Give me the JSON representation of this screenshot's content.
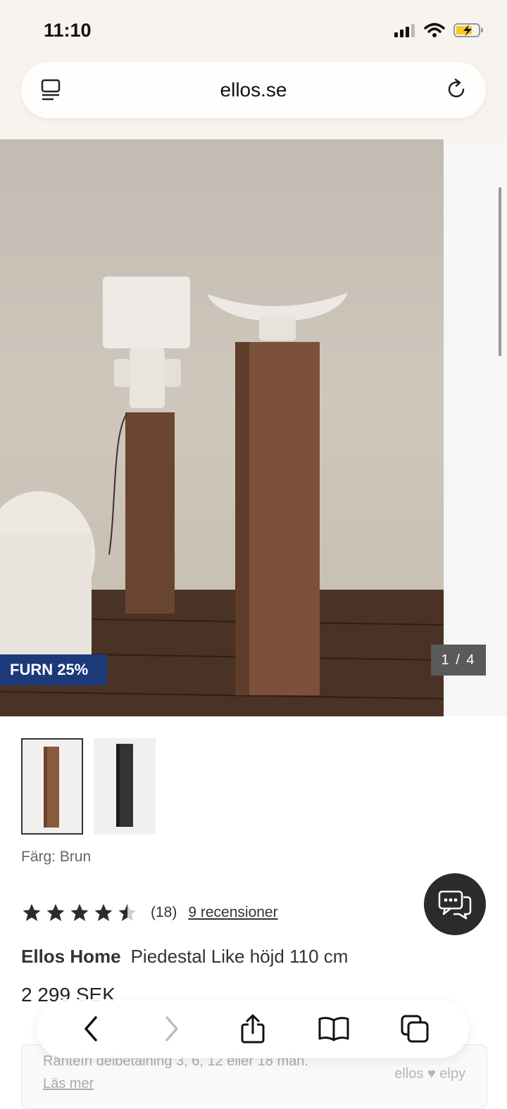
{
  "status": {
    "time": "11:10"
  },
  "browser": {
    "url": "ellos.se"
  },
  "gallery": {
    "badge": "FURN 25%",
    "counter": "1 / 4"
  },
  "product": {
    "color_label": "Färg: Brun",
    "rating": {
      "value": 4.5,
      "max": 5,
      "count": "(18)",
      "reviews_link": "9 recensioner"
    },
    "brand": "Ellos Home",
    "name": "Piedestal Like höjd 110 cm",
    "price": "2 299 SEK"
  },
  "finance": {
    "text": "Räntefri delbetalning 3, 6, 12 eller 18 mån.",
    "link": "Läs mer",
    "brand": "ellos ♥ elpy"
  },
  "icons": {
    "tabs": "tabs-icon",
    "reload": "reload-icon",
    "back": "back-icon",
    "forward": "forward-icon",
    "share": "share-icon",
    "bookmarks": "bookmarks-icon",
    "tab-overview": "tab-overview-icon",
    "chat": "chat-icon"
  }
}
